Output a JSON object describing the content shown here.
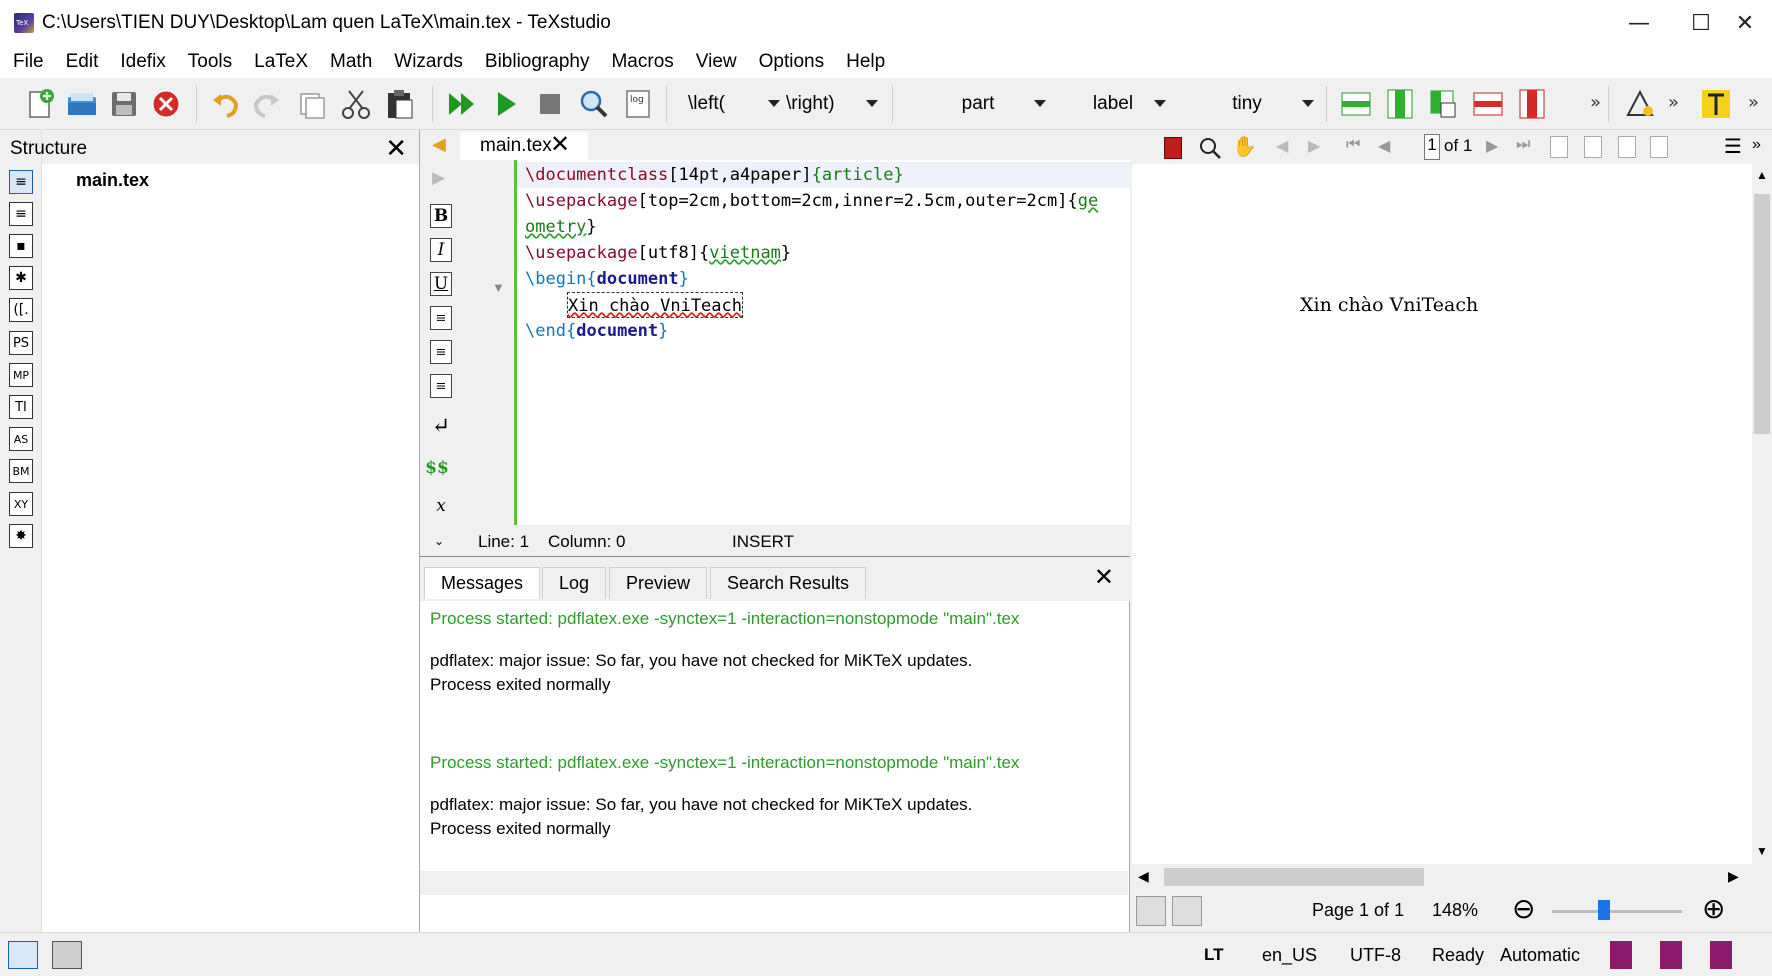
{
  "window": {
    "title": "C:\\Users\\TIEN DUY\\Desktop\\Lam quen LaTeX\\main.tex - TeXstudio",
    "minimize": "—",
    "maximize": "☐",
    "close": "✕"
  },
  "menu": [
    "File",
    "Edit",
    "Idefix",
    "Tools",
    "LaTeX",
    "Math",
    "Wizards",
    "Bibliography",
    "Macros",
    "View",
    "Options",
    "Help"
  ],
  "toolbar": {
    "left_paren": "\\left(",
    "right_paren": "\\right)",
    "sectioning": "part",
    "references": "label",
    "size": "tiny",
    "log_label": "log"
  },
  "structure": {
    "title": "Structure",
    "file": "main.tex",
    "side_icons": [
      "≡",
      "≡",
      "▪",
      "✱",
      "([.",
      "PS",
      "MP",
      "TI",
      "AS",
      "BM",
      "XY",
      "✸"
    ]
  },
  "editor": {
    "tab_label": "main.tex",
    "side_buttons": [
      "B",
      "I",
      "U",
      "≡",
      "≡",
      "≡",
      "↵",
      "$$",
      "x"
    ],
    "code": {
      "l1_cmd": "\\documentclass",
      "l1_opt": "[14pt,a4paper]",
      "l1_arg": "{article}",
      "l2_cmd": "\\usepackage",
      "l2_opt": "[top=2cm,bottom=2cm,inner=2.5cm,outer=2cm]",
      "l2_arg_a": "ge",
      "l3_arg_b": "ometry",
      "l3_close": "}",
      "l4_cmd": "\\usepackage",
      "l4_opt": "[utf8]",
      "l4_arg": "vietnam",
      "l5_cmd": "\\begin",
      "l5_arg": "document",
      "l6_text": "Xin chào VniTeach",
      "l7_cmd": "\\end",
      "l7_arg": "document"
    },
    "status": {
      "line": "Line: 1",
      "column": "Column: 0",
      "mode": "INSERT"
    }
  },
  "messages": {
    "tabs": [
      "Messages",
      "Log",
      "Preview",
      "Search Results"
    ],
    "lines": [
      "Process started: pdflatex.exe -synctex=1 -interaction=nonstopmode \"main\".tex",
      "pdflatex: major issue: So far, you have not checked for MiKTeX updates.",
      "Process exited normally",
      "Process started: pdflatex.exe -synctex=1 -interaction=nonstopmode \"main\".tex",
      "pdflatex: major issue: So far, you have not checked for MiKTeX updates.",
      "Process exited normally"
    ]
  },
  "preview": {
    "page_input": "1",
    "page_of": "of 1",
    "content_text": "Xin chào VniTeach",
    "page_label": "Page 1 of 1",
    "zoom": "148%",
    "zoom_fraction": 0.4
  },
  "statusbar": {
    "lang": "en_US",
    "encoding": "UTF-8",
    "state": "Ready",
    "mode": "Automatic",
    "lt": "LT"
  },
  "colors": {
    "green_message": "#2e9b2e",
    "keyword": "#8b0a2a",
    "argument": "#1a7a1a",
    "editor_bar": "#5bc236"
  }
}
